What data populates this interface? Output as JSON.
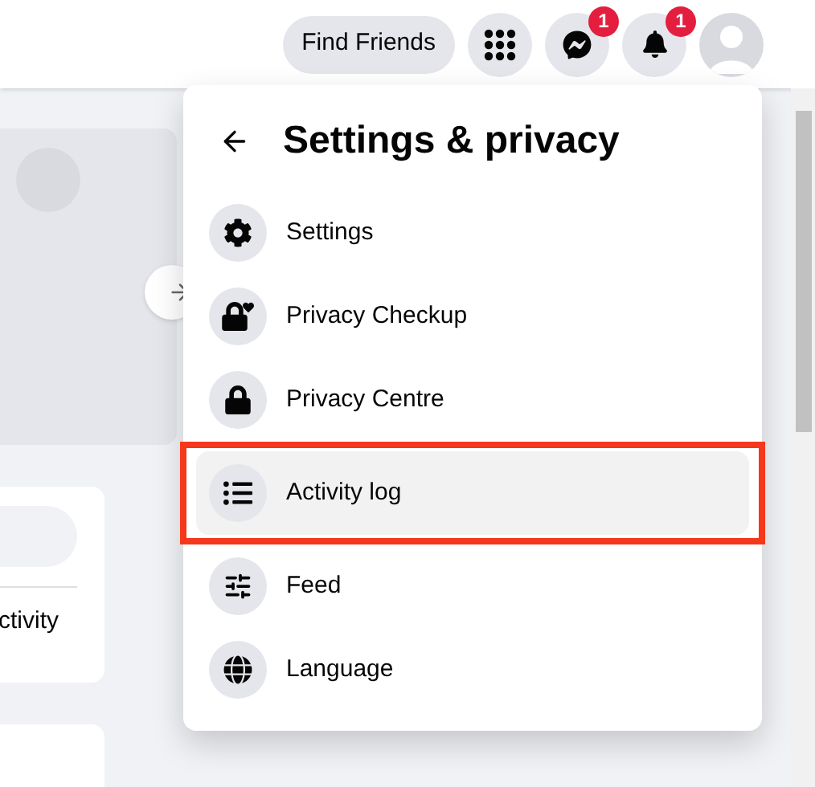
{
  "top_bar": {
    "find_friends": "Find Friends",
    "messenger_badge": "1",
    "notifications_badge": "1"
  },
  "left_column": {
    "activity_text": "ctivity"
  },
  "menu": {
    "title": "Settings & privacy",
    "items": [
      {
        "kind": "settings",
        "label": "Settings",
        "selected": false
      },
      {
        "kind": "privacy_checkup",
        "label": "Privacy Checkup",
        "selected": false
      },
      {
        "kind": "privacy_centre",
        "label": "Privacy Centre",
        "selected": false
      },
      {
        "kind": "activity_log",
        "label": "Activity log",
        "selected": true
      },
      {
        "kind": "feed",
        "label": "Feed",
        "selected": false
      },
      {
        "kind": "language",
        "label": "Language",
        "selected": false
      }
    ]
  }
}
